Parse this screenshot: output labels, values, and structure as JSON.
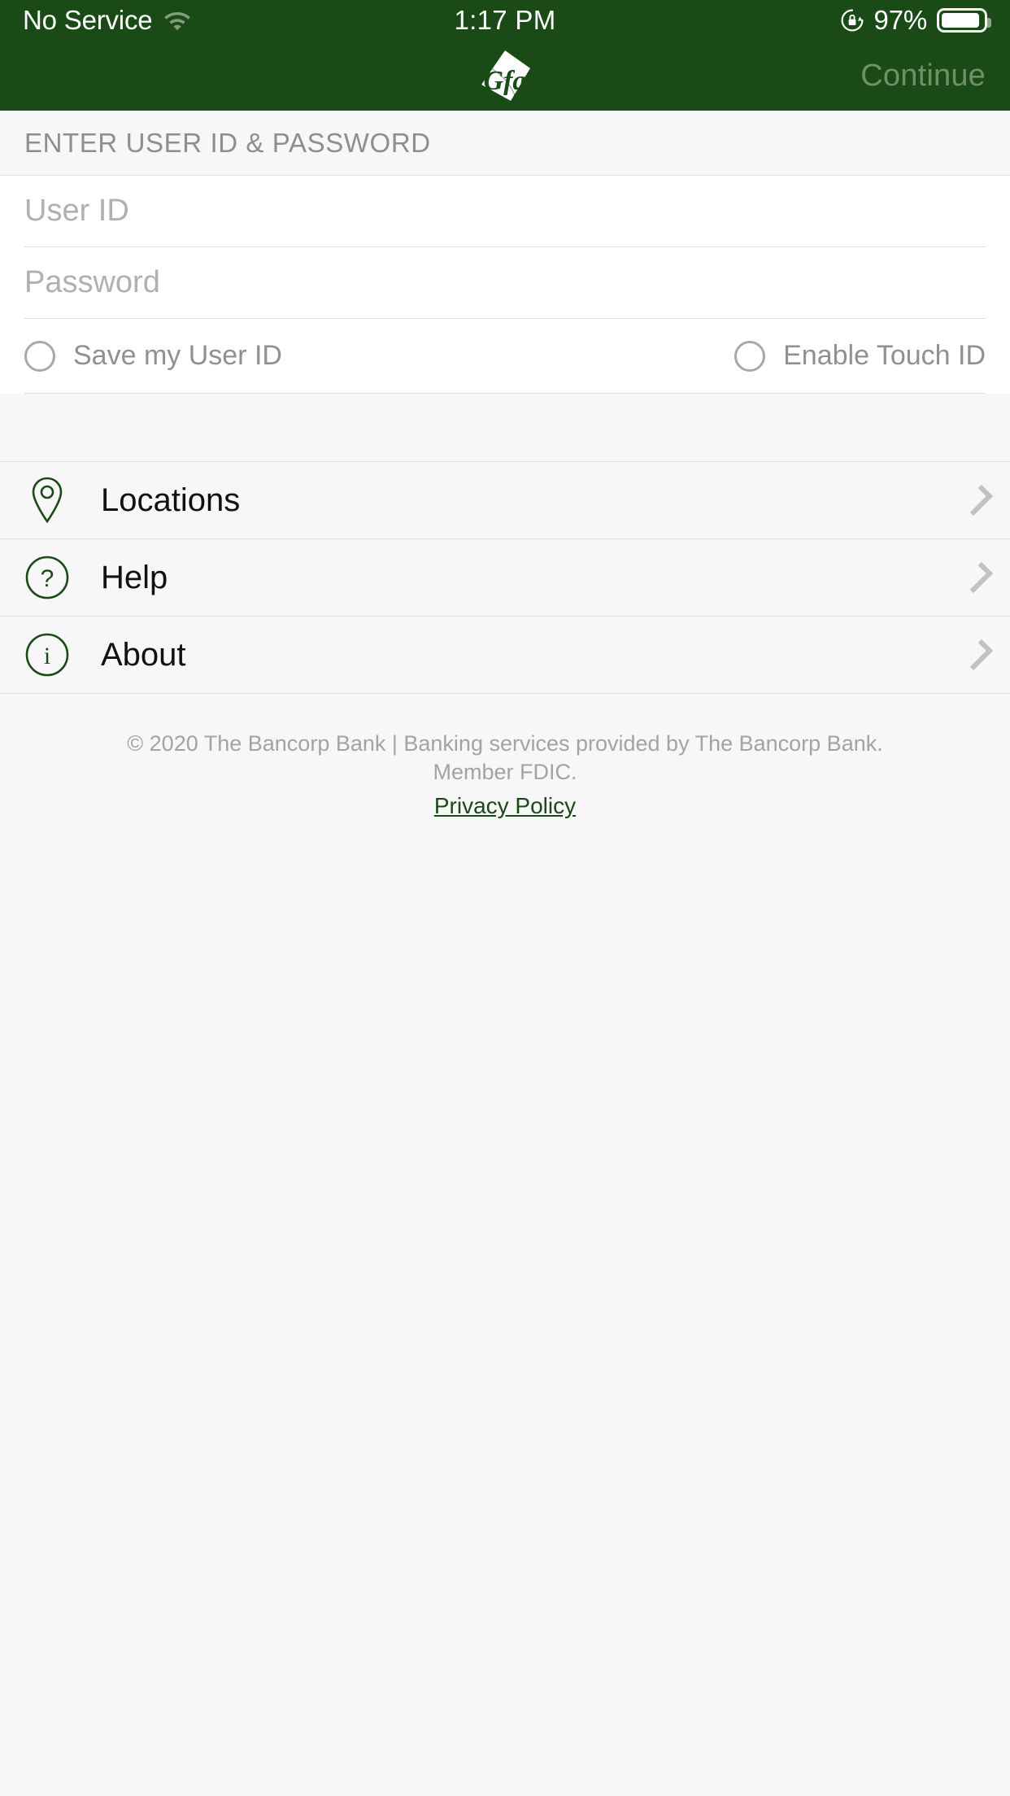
{
  "status_bar": {
    "carrier": "No Service",
    "time": "1:17 PM",
    "battery_percent": "97%",
    "wifi_icon": "wifi-icon",
    "rotation_lock_icon": "rotation-lock-icon",
    "battery_icon": "battery-icon"
  },
  "nav_bar": {
    "logo_icon": "gfa-leaf-logo",
    "logo_text": "Gfa",
    "continue_label": "Continue",
    "continue_enabled": false
  },
  "section": {
    "header": "ENTER USER ID & PASSWORD"
  },
  "form": {
    "user_id": {
      "value": "",
      "placeholder": "User ID"
    },
    "password": {
      "value": "",
      "placeholder": "Password"
    },
    "toggles": [
      {
        "label": "Save my User ID",
        "checked": false
      },
      {
        "label": "Enable Touch ID",
        "checked": false
      }
    ]
  },
  "menu": {
    "items": [
      {
        "label": "Locations",
        "icon": "map-pin-icon"
      },
      {
        "label": "Help",
        "icon": "question-circle-icon"
      },
      {
        "label": "About",
        "icon": "info-circle-icon"
      }
    ]
  },
  "footer": {
    "copyright_line1": "© 2020 The Bancorp Bank | Banking services provided by The Bancorp Bank.",
    "copyright_line2": "Member FDIC.",
    "privacy_label": "Privacy Policy"
  },
  "colors": {
    "brand_green": "#1a4a16",
    "page_bg": "#f7f7f7",
    "field_bg": "#ffffff",
    "muted_text": "#909090",
    "chevron": "#c2c2c2"
  }
}
